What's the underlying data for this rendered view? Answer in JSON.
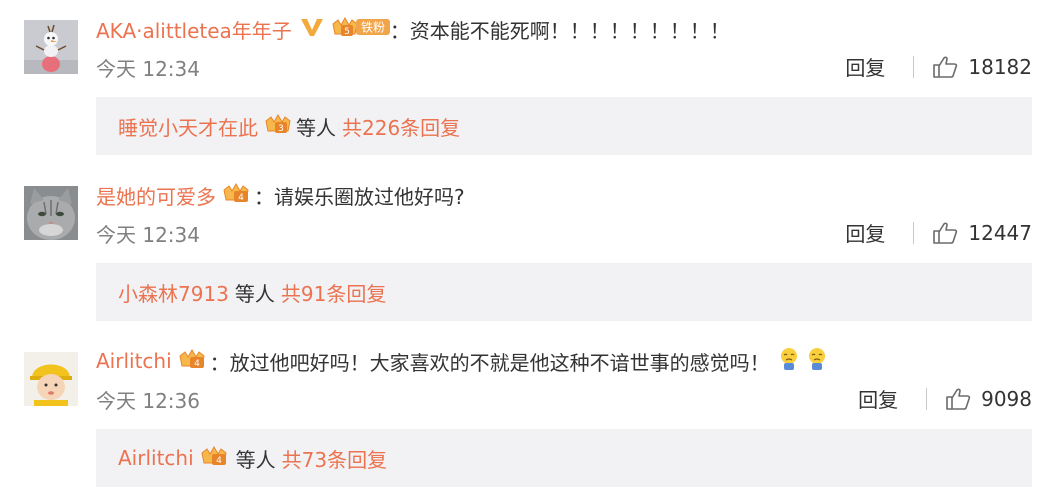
{
  "comments": [
    {
      "username": "AKA·alittletea年年子",
      "fan_badge_label": "铁粉",
      "text": "：资本能不能死啊！！！！！！！！！",
      "time": "今天 12:34",
      "reply_label": "回复",
      "likes": "18182",
      "replies": {
        "first_user": "睡觉小天才在此",
        "etc": "等人",
        "count": "共226条回复"
      }
    },
    {
      "username": "是她的可爱多",
      "text": "：请娱乐圈放过他好吗?",
      "time": "今天 12:34",
      "reply_label": "回复",
      "likes": "12447",
      "replies": {
        "first_user": "小森林7913",
        "etc": "等人",
        "count": "共91条回复"
      }
    },
    {
      "username": "Airlitchi",
      "text": "：放过他吧好吗！大家喜欢的不就是他这种不谙世事的感觉吗！",
      "time": "今天 12:36",
      "reply_label": "回复",
      "likes": "9098",
      "replies": {
        "first_user": "Airlitchi",
        "etc": "等人",
        "count": "共73条回复"
      }
    }
  ],
  "colors": {
    "username": "#eb7350",
    "text": "#333333",
    "meta": "#808080",
    "reply_bg": "#f2f2f5"
  },
  "icons": [
    "crown-badge-icon",
    "vip-v-icon",
    "thumb-up-icon",
    "sad-emoji-icon"
  ]
}
